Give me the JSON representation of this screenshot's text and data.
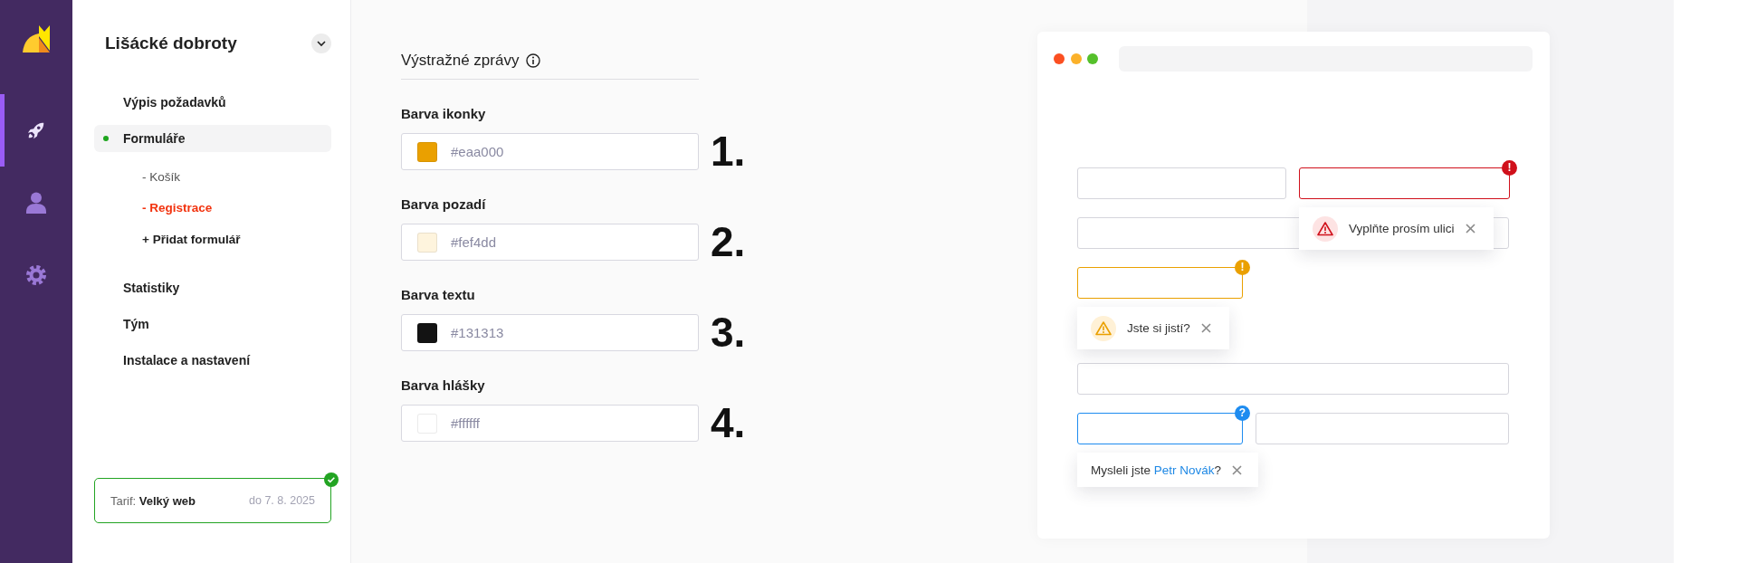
{
  "nav_rail": {
    "items": [
      {
        "selected": true
      },
      {
        "selected": false
      },
      {
        "selected": false
      }
    ]
  },
  "sidebar": {
    "title": "Lišácké dobroty",
    "items": [
      {
        "label": "Výpis požadavků",
        "selected": false
      },
      {
        "label": "Formuláře",
        "selected": true,
        "children": [
          {
            "label": "- Košík",
            "kind": "form",
            "selected": false
          },
          {
            "label": "- Registrace",
            "kind": "form",
            "selected": true
          },
          {
            "label": "+ Přidat formulář",
            "kind": "add"
          }
        ]
      },
      {
        "label": "Statistiky",
        "selected": false
      },
      {
        "label": "Tým",
        "selected": false
      },
      {
        "label": "Instalace a nastavení",
        "selected": false
      }
    ],
    "plan": {
      "label": "Tarif:",
      "name": "Velký web",
      "expiry": "do 7. 8. 2025"
    }
  },
  "form": {
    "title": "Výstražné zprávy",
    "fields": [
      {
        "label": "Barva ikonky",
        "value": "#eaa000",
        "color": "#eaa000",
        "number": "1."
      },
      {
        "label": "Barva pozadí",
        "value": "#fef4dd",
        "color": "#fef4dd",
        "number": "2."
      },
      {
        "label": "Barva textu",
        "value": "#131313",
        "color": "#131313",
        "number": "3."
      },
      {
        "label": "Barva hlášky",
        "value": "#ffffff",
        "color": "#ffffff",
        "number": "4."
      }
    ]
  },
  "preview": {
    "rows": [
      {
        "fields": [
          {
            "kind": "plain"
          },
          {
            "kind": "error",
            "badge": "!",
            "tooltip": {
              "kind": "alert",
              "text": "Vyplňte prosím ulici"
            }
          }
        ]
      },
      {
        "fields": [
          {
            "kind": "plain"
          }
        ]
      },
      {
        "fields": [
          {
            "kind": "warning",
            "badge": "!",
            "tooltip": {
              "kind": "alert",
              "text": "Jste si jistí?"
            }
          }
        ]
      },
      {
        "fields": [
          {
            "kind": "plain"
          }
        ]
      },
      {
        "fields": [
          {
            "kind": "info",
            "badge": "?",
            "tooltip": {
              "kind": "suggestion",
              "text": "Mysleli jste ",
              "link": "Petr Novák",
              "text_after": "?"
            }
          },
          {
            "kind": "plain"
          }
        ]
      }
    ]
  }
}
